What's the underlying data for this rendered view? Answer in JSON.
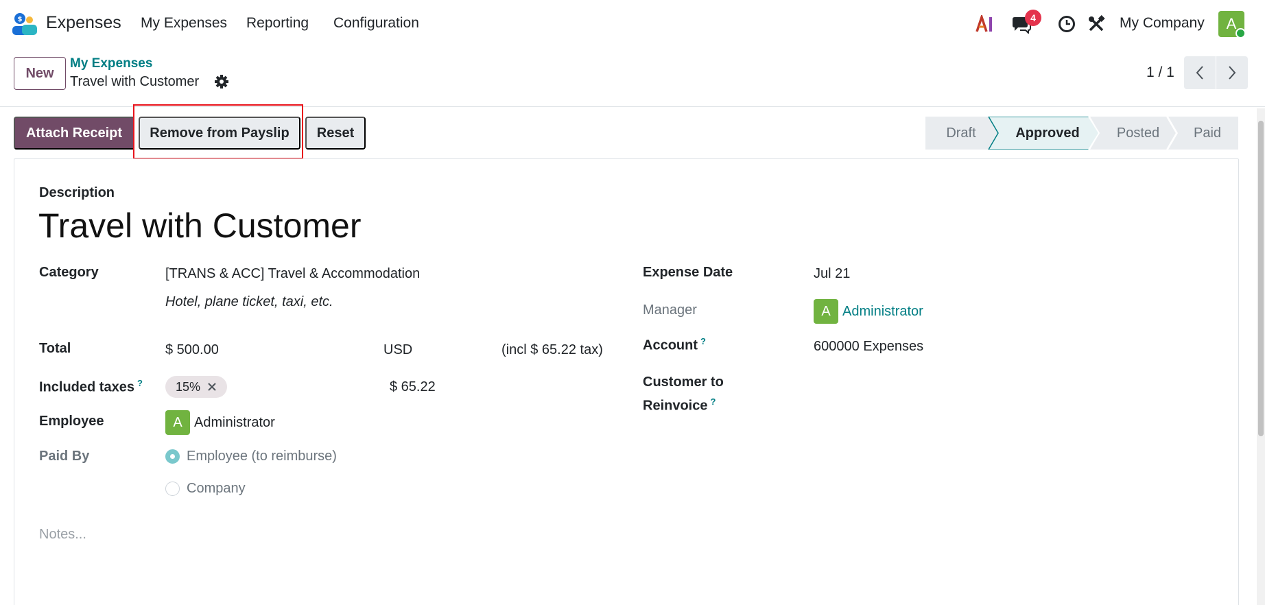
{
  "navbar": {
    "app_name": "Expenses",
    "menu": [
      "My Expenses",
      "Reporting",
      "Configuration"
    ],
    "message_badge": "4",
    "company": "My Company",
    "avatar_letter": "A",
    "icons": [
      "ai-icon",
      "chat-icon",
      "clock-icon",
      "tools-icon"
    ]
  },
  "control_panel": {
    "new_label": "New",
    "breadcrumb_parent": "My Expenses",
    "breadcrumb_current": "Travel with Customer",
    "pager": "1 / 1"
  },
  "actions": {
    "attach_receipt": "Attach Receipt",
    "remove_from_payslip": "Remove from Payslip",
    "reset": "Reset"
  },
  "statusbar": {
    "stages": [
      "Draft",
      "Approved",
      "Posted",
      "Paid"
    ],
    "active": "Approved"
  },
  "form": {
    "description_label": "Description",
    "title": "Travel with Customer",
    "category_label": "Category",
    "category_value": "[TRANS & ACC] Travel & Accommodation",
    "category_hint": "Hotel, plane ticket, taxi, etc.",
    "total_label": "Total",
    "total_amount": "$ 500.00",
    "currency": "USD",
    "incl_tax": "(incl $ 65.22 tax)",
    "taxes_label": "Included taxes",
    "tax_tag": "15%",
    "tax_amount": "$ 65.22",
    "employee_label": "Employee",
    "employee_avatar": "A",
    "employee_value": "Administrator",
    "paid_by_label": "Paid By",
    "paid_by_options": [
      "Employee (to reimburse)",
      "Company"
    ],
    "notes_placeholder": "Notes...",
    "expense_date_label": "Expense Date",
    "expense_date": "Jul 21",
    "manager_label": "Manager",
    "manager_avatar": "A",
    "manager_value": "Administrator",
    "account_label": "Account",
    "account_value": "600000 Expenses",
    "reinvoice_label_1": "Customer to",
    "reinvoice_label_2": "Reinvoice",
    "help_mark": "?"
  },
  "colors": {
    "brand": "#714b67",
    "link": "#017e84",
    "highlight": "#e8131c",
    "avatar": "#71b340",
    "badge": "#e4334d"
  }
}
